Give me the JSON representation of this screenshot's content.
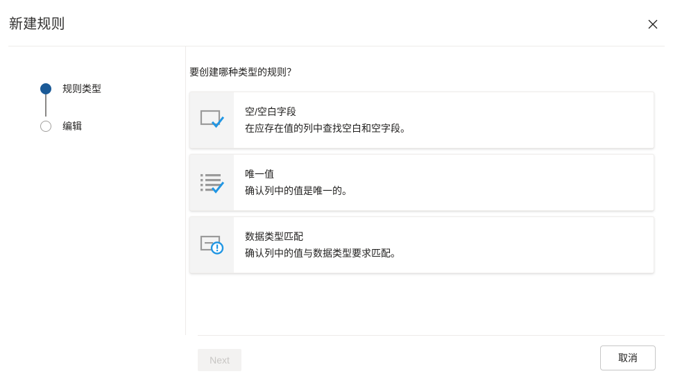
{
  "dialog": {
    "title": "新建规则",
    "close_icon": "close-icon"
  },
  "sidebar": {
    "steps": [
      {
        "label": "规则类型",
        "state": "active"
      },
      {
        "label": "编辑",
        "state": "inactive"
      }
    ]
  },
  "content": {
    "question": "要创建哪种类型的规则？",
    "options": [
      {
        "icon": "empty-field-check-icon",
        "title": "空/空白字段",
        "description": "在应存在值的列中查找空白和空字段。"
      },
      {
        "icon": "unique-list-check-icon",
        "title": "唯一值",
        "description": "确认列中的值是唯一的。"
      },
      {
        "icon": "data-type-alert-icon",
        "title": "数据类型匹配",
        "description": "确认列中的值与数据类型要求匹配。"
      }
    ]
  },
  "footer": {
    "next_label": "Next",
    "cancel_label": "取消"
  },
  "colors": {
    "accent_blue": "#1b5a97",
    "check_blue": "#2196e3",
    "icon_gray": "#9a9a9a",
    "divider": "#edebe9",
    "icon_panel_bg": "#f4f4f4",
    "disabled_text": "#c8c6c4",
    "disabled_bg": "#f3f2f1"
  }
}
